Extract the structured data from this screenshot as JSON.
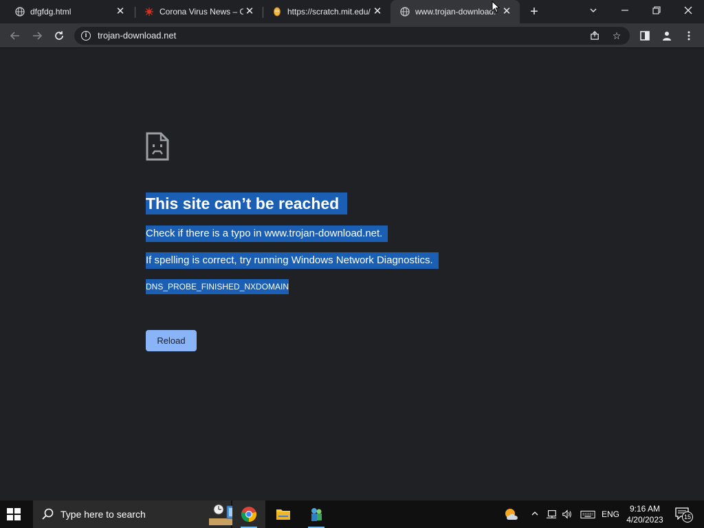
{
  "tabs": [
    {
      "title": "dfgfdg.html",
      "icon": "globe-icon"
    },
    {
      "title": "Corona Virus News – Co",
      "icon": "virus-icon"
    },
    {
      "title": "https://scratch.mit.edu/",
      "icon": "scratch-icon"
    },
    {
      "title": "www.trojan-download.",
      "icon": "globe-icon",
      "active": true
    }
  ],
  "toolbar": {
    "url": "trojan-download.net"
  },
  "error": {
    "heading": "This site can’t be reached",
    "check_text": "Check if there is a typo in www.trojan-download.net.",
    "diagnostics_text": "If spelling is correct, try running Windows Network Diagnostics.",
    "code": "DNS_PROBE_FINISHED_NXDOMAIN",
    "reload_label": "Reload"
  },
  "taskbar": {
    "search_placeholder": "Type here to search",
    "language": "ENG",
    "time": "9:16 AM",
    "date": "4/20/2023",
    "notification_count": "15"
  },
  "colors": {
    "background": "#202124",
    "selection": "#1a5fb4",
    "reload_button": "#8ab4f8"
  }
}
